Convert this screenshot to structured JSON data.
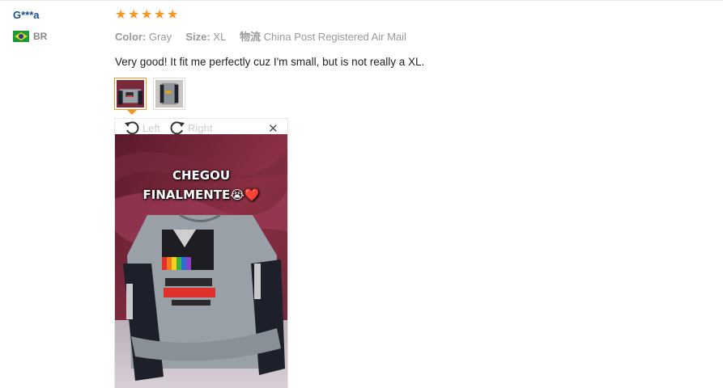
{
  "reviewer": {
    "name": "G***a",
    "country_code": "BR",
    "flag_icon": "brazil-flag-icon"
  },
  "review": {
    "rating": 5,
    "stars": [
      "★",
      "★",
      "★",
      "★",
      "★"
    ],
    "color_label": "Color:",
    "color_value": "Gray",
    "size_label": "Size:",
    "size_value": "XL",
    "shipping_label": "物流",
    "shipping_value": "China Post Registered Air Mail",
    "text": "Very good! It fit me perfectly cuz I'm small, but is not really a XL."
  },
  "viewer": {
    "rotate_left_label": "Left",
    "rotate_right_label": "Right",
    "close_symbol": "✕",
    "photo_caption_line1": "CHEGOU",
    "photo_caption_line2": "FINALMENTE😭❤️"
  },
  "colors": {
    "accent": "#f7941d",
    "name": "#1a4d8f"
  }
}
